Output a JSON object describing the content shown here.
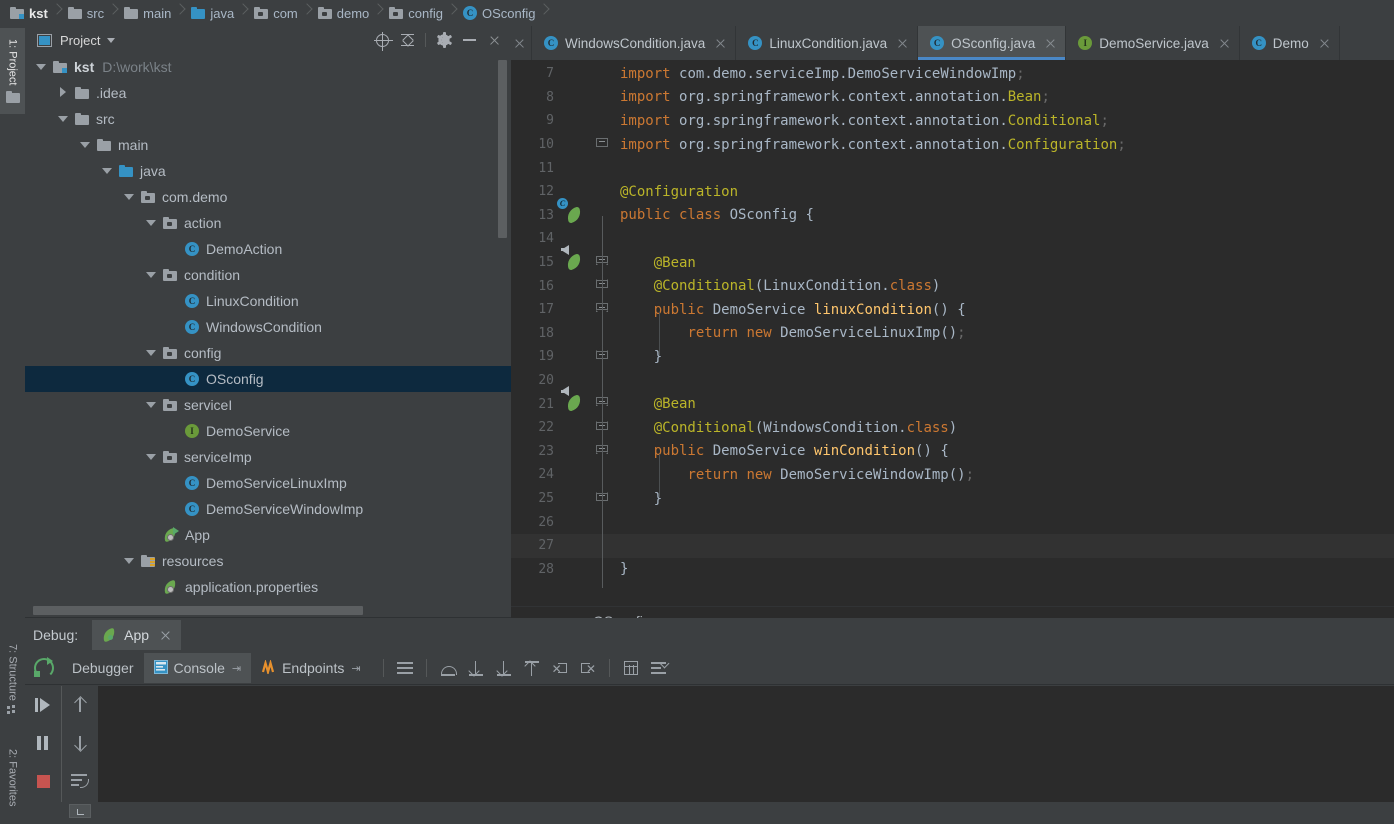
{
  "breadcrumb": {
    "items": [
      {
        "label": "kst",
        "icon": "module-folder-icon"
      },
      {
        "label": "src",
        "icon": "folder-icon"
      },
      {
        "label": "main",
        "icon": "folder-icon"
      },
      {
        "label": "java",
        "icon": "source-folder-icon"
      },
      {
        "label": "com",
        "icon": "package-icon"
      },
      {
        "label": "demo",
        "icon": "package-icon"
      },
      {
        "label": "config",
        "icon": "package-icon"
      },
      {
        "label": "OSconfig",
        "icon": "class-icon"
      }
    ]
  },
  "left_strip": {
    "project": "1: Project",
    "structure": "7: Structure",
    "favorites": "2: Favorites"
  },
  "project_panel": {
    "title": "Project",
    "tools": [
      "locate-icon",
      "collapse-all-icon",
      "gear-icon",
      "minimize-icon",
      "close-icon"
    ],
    "tree": [
      {
        "label": "kst",
        "sub": "D:\\work\\kst",
        "depth": 0,
        "arrow": "down",
        "icon": "module-folder-icon",
        "bold": true,
        "selected": false
      },
      {
        "label": ".idea",
        "sub": "",
        "depth": 1,
        "arrow": "right",
        "icon": "folder-icon",
        "bold": false,
        "selected": false
      },
      {
        "label": "src",
        "sub": "",
        "depth": 1,
        "arrow": "down",
        "icon": "folder-icon",
        "bold": false,
        "selected": false
      },
      {
        "label": "main",
        "sub": "",
        "depth": 2,
        "arrow": "down",
        "icon": "folder-icon",
        "bold": false,
        "selected": false
      },
      {
        "label": "java",
        "sub": "",
        "depth": 3,
        "arrow": "down",
        "icon": "source-folder-icon",
        "bold": false,
        "selected": false
      },
      {
        "label": "com.demo",
        "sub": "",
        "depth": 4,
        "arrow": "down",
        "icon": "package-icon",
        "bold": false,
        "selected": false
      },
      {
        "label": "action",
        "sub": "",
        "depth": 5,
        "arrow": "down",
        "icon": "package-icon",
        "bold": false,
        "selected": false
      },
      {
        "label": "DemoAction",
        "sub": "",
        "depth": 6,
        "arrow": "none",
        "icon": "class-icon",
        "bold": false,
        "selected": false
      },
      {
        "label": "condition",
        "sub": "",
        "depth": 5,
        "arrow": "down",
        "icon": "package-icon",
        "bold": false,
        "selected": false
      },
      {
        "label": "LinuxCondition",
        "sub": "",
        "depth": 6,
        "arrow": "none",
        "icon": "class-icon",
        "bold": false,
        "selected": false
      },
      {
        "label": "WindowsCondition",
        "sub": "",
        "depth": 6,
        "arrow": "none",
        "icon": "class-icon",
        "bold": false,
        "selected": false
      },
      {
        "label": "config",
        "sub": "",
        "depth": 5,
        "arrow": "down",
        "icon": "package-icon",
        "bold": false,
        "selected": false
      },
      {
        "label": "OSconfig",
        "sub": "",
        "depth": 6,
        "arrow": "none",
        "icon": "class-icon",
        "bold": false,
        "selected": true
      },
      {
        "label": "serviceI",
        "sub": "",
        "depth": 5,
        "arrow": "down",
        "icon": "package-icon",
        "bold": false,
        "selected": false
      },
      {
        "label": "DemoService",
        "sub": "",
        "depth": 6,
        "arrow": "none",
        "icon": "interface-icon",
        "bold": false,
        "selected": false
      },
      {
        "label": "serviceImp",
        "sub": "",
        "depth": 5,
        "arrow": "down",
        "icon": "package-icon",
        "bold": false,
        "selected": false
      },
      {
        "label": "DemoServiceLinuxImp",
        "sub": "",
        "depth": 6,
        "arrow": "none",
        "icon": "class-icon",
        "bold": false,
        "selected": false
      },
      {
        "label": "DemoServiceWindowImp",
        "sub": "",
        "depth": 6,
        "arrow": "none",
        "icon": "class-icon",
        "bold": false,
        "selected": false
      },
      {
        "label": "App",
        "sub": "",
        "depth": 5,
        "arrow": "none",
        "icon": "spring-run-icon",
        "bold": false,
        "selected": false
      },
      {
        "label": "resources",
        "sub": "",
        "depth": 4,
        "arrow": "down",
        "icon": "resources-folder-icon",
        "bold": false,
        "selected": false
      },
      {
        "label": "application.properties",
        "sub": "",
        "depth": 5,
        "arrow": "none",
        "icon": "spring-properties-icon",
        "bold": false,
        "selected": false
      }
    ]
  },
  "editor": {
    "tabs": [
      {
        "label": "WindowsCondition.java",
        "icon": "class-icon",
        "active": false
      },
      {
        "label": "LinuxCondition.java",
        "icon": "class-icon",
        "active": false
      },
      {
        "label": "OSconfig.java",
        "icon": "class-icon",
        "active": true
      },
      {
        "label": "DemoService.java",
        "icon": "interface-icon",
        "active": false
      },
      {
        "label": "Demo",
        "icon": "class-icon",
        "active": false
      }
    ],
    "breadcrumb": "OSconfig",
    "current_line": 27,
    "lines": [
      {
        "num": 7,
        "indent": 0,
        "tokens": [
          [
            "kw",
            "import "
          ],
          [
            "plain",
            "com."
          ],
          [
            "plain",
            "demo."
          ],
          [
            "plain",
            "serviceImp."
          ],
          [
            "plain",
            "DemoServiceWindowImp"
          ],
          [
            "semi",
            ";"
          ]
        ]
      },
      {
        "num": 8,
        "indent": 0,
        "tokens": [
          [
            "kw",
            "import "
          ],
          [
            "plain",
            "org."
          ],
          [
            "plain",
            "springframework."
          ],
          [
            "plain",
            "context."
          ],
          [
            "plain",
            "annotation."
          ],
          [
            "ann",
            "Bean"
          ],
          [
            "semi",
            ";"
          ]
        ]
      },
      {
        "num": 9,
        "indent": 0,
        "tokens": [
          [
            "kw",
            "import "
          ],
          [
            "plain",
            "org."
          ],
          [
            "plain",
            "springframework."
          ],
          [
            "plain",
            "context."
          ],
          [
            "plain",
            "annotation."
          ],
          [
            "ann",
            "Conditional"
          ],
          [
            "semi",
            ";"
          ]
        ]
      },
      {
        "num": 10,
        "indent": 0,
        "tokens": [
          [
            "kw",
            "import "
          ],
          [
            "plain",
            "org."
          ],
          [
            "plain",
            "springframework."
          ],
          [
            "plain",
            "context."
          ],
          [
            "plain",
            "annotation."
          ],
          [
            "ann",
            "Configuration"
          ],
          [
            "semi",
            ";"
          ]
        ]
      },
      {
        "num": 11,
        "indent": 0,
        "tokens": []
      },
      {
        "num": 12,
        "indent": 0,
        "tokens": [
          [
            "ann",
            "@Configuration"
          ]
        ]
      },
      {
        "num": 13,
        "indent": 0,
        "tokens": [
          [
            "kw",
            "public class "
          ],
          [
            "plain",
            "OSconfig"
          ],
          [
            "plain",
            " {"
          ]
        ]
      },
      {
        "num": 14,
        "indent": 0,
        "tokens": []
      },
      {
        "num": 15,
        "indent": 1,
        "tokens": [
          [
            "ann",
            "@Bean"
          ]
        ]
      },
      {
        "num": 16,
        "indent": 1,
        "tokens": [
          [
            "ann",
            "@Conditional"
          ],
          [
            "plain",
            "(LinuxCondition."
          ],
          [
            "kw",
            "class"
          ],
          [
            "plain",
            ")"
          ]
        ]
      },
      {
        "num": 17,
        "indent": 1,
        "tokens": [
          [
            "kw",
            "public "
          ],
          [
            "plain",
            "DemoService "
          ],
          [
            "meth",
            "linuxCondition"
          ],
          [
            "plain",
            "() {"
          ]
        ]
      },
      {
        "num": 18,
        "indent": 2,
        "tokens": [
          [
            "kw",
            "return new "
          ],
          [
            "plain",
            "DemoServiceLinuxImp"
          ],
          [
            "plain",
            "()"
          ],
          [
            "semi",
            ";"
          ]
        ]
      },
      {
        "num": 19,
        "indent": 1,
        "tokens": [
          [
            "plain",
            "}"
          ]
        ]
      },
      {
        "num": 20,
        "indent": 0,
        "tokens": []
      },
      {
        "num": 21,
        "indent": 1,
        "tokens": [
          [
            "ann",
            "@Bean"
          ]
        ]
      },
      {
        "num": 22,
        "indent": 1,
        "tokens": [
          [
            "ann",
            "@Conditional"
          ],
          [
            "plain",
            "(WindowsCondition."
          ],
          [
            "kw",
            "class"
          ],
          [
            "plain",
            ")"
          ]
        ]
      },
      {
        "num": 23,
        "indent": 1,
        "tokens": [
          [
            "kw",
            "public "
          ],
          [
            "plain",
            "DemoService "
          ],
          [
            "meth",
            "winCondition"
          ],
          [
            "plain",
            "() {"
          ]
        ]
      },
      {
        "num": 24,
        "indent": 2,
        "tokens": [
          [
            "kw",
            "return new "
          ],
          [
            "plain",
            "DemoServiceWindowImp"
          ],
          [
            "plain",
            "()"
          ],
          [
            "semi",
            ";"
          ]
        ]
      },
      {
        "num": 25,
        "indent": 1,
        "tokens": [
          [
            "plain",
            "}"
          ]
        ]
      },
      {
        "num": 26,
        "indent": 0,
        "tokens": []
      },
      {
        "num": 27,
        "indent": 0,
        "tokens": []
      },
      {
        "num": 28,
        "indent": 0,
        "tokens": [
          [
            "plain",
            "}"
          ]
        ]
      }
    ]
  },
  "debug": {
    "title": "Debug:",
    "config_name": "App",
    "config_icon": "spring-boot-icon",
    "tabs": [
      {
        "label": "Debugger",
        "icon": "",
        "active": false,
        "pinned": false
      },
      {
        "label": "Console",
        "icon": "console-icon",
        "active": true,
        "pinned": true
      },
      {
        "label": "Endpoints",
        "icon": "endpoints-icon",
        "active": false,
        "pinned": true
      }
    ],
    "toolbar_icons": [
      "menu-icon",
      "step-over-icon",
      "step-into-icon",
      "force-step-into-icon",
      "step-out-icon",
      "run-to-cursor-icon",
      "drop-frame-icon",
      "evaluate-expression-icon",
      "settings-icon"
    ],
    "left_controls": [
      "rerun-icon",
      "resume-icon",
      "pause-icon",
      "stop-icon"
    ],
    "left_controls2": [
      "arrow-up-icon",
      "arrow-down-icon",
      "soft-wrap-icon",
      "more-icon"
    ]
  },
  "colors": {
    "accent": "#3592c4",
    "tab_underline": "#4a88c7",
    "selection": "#0d293e",
    "editor_bg": "#2b2b2b",
    "panel_bg": "#3c3f41",
    "keyword": "#cc7832",
    "annotation": "#bbb529",
    "method": "#ffc66d",
    "text": "#a9b7c6",
    "stop_red": "#c75450",
    "spring_green": "#6aa84f"
  }
}
